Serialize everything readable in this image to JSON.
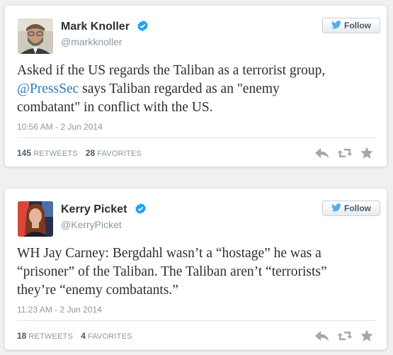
{
  "colors": {
    "verified": "#1da1f2",
    "mention": "#2b7bb9",
    "twitter_blue": "#55acee",
    "action_icon": "#a1a8ae"
  },
  "tweets": [
    {
      "display_name": "Mark Knoller",
      "screen_name": "@markknoller",
      "follow_label": "Follow",
      "text_lines": [
        {
          "before": "Asked if the US regards the Taliban as a terrorist group,"
        },
        {
          "mention": "@PressSec",
          "after": " says Taliban regarded as an \"enemy"
        },
        {
          "before": "combatant\" in conflict with the US."
        }
      ],
      "timestamp": "10:56 AM - 2 Jun 2014",
      "retweets": "145",
      "retweets_label": "RETWEETS",
      "favorites": "28",
      "favorites_label": "FAVORITES",
      "icons": [
        "verified-badge-icon",
        "twitter-bird-icon",
        "reply-icon",
        "retweet-icon",
        "favorite-star-icon"
      ]
    },
    {
      "display_name": "Kerry Picket",
      "screen_name": "@KerryPicket",
      "follow_label": "Follow",
      "text_lines": [
        {
          "before": "WH Jay Carney: Bergdahl wasn’t a “hostage” he was a"
        },
        {
          "before": "“prisoner” of the Taliban. The Taliban aren’t “terrorists”"
        },
        {
          "before": "they’re “enemy combatants.”"
        }
      ],
      "timestamp": "11:23 AM - 2 Jun 2014",
      "retweets": "18",
      "retweets_label": "RETWEETS",
      "favorites": "4",
      "favorites_label": "FAVORITES",
      "icons": [
        "verified-badge-icon",
        "twitter-bird-icon",
        "reply-icon",
        "retweet-icon",
        "favorite-star-icon"
      ]
    }
  ]
}
